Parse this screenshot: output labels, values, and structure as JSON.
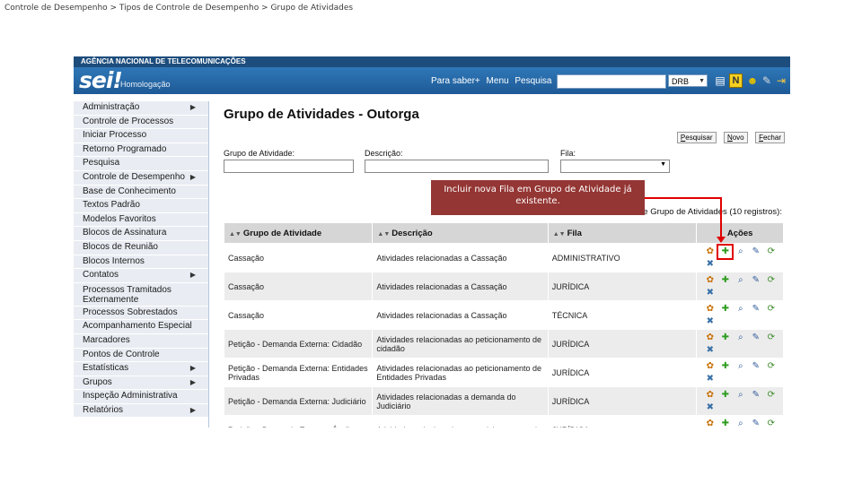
{
  "breadcrumb": "Controle de Desempenho > Tipos de Controle de Desempenho > Grupo de Atividades",
  "header": {
    "org": "AGÊNCIA NACIONAL DE TELECOMUNICAÇÕES",
    "logo": "sei!",
    "env": "Homologação",
    "links": [
      "Para saber+",
      "Menu",
      "Pesquisa"
    ],
    "unit": "DRB",
    "n_badge": "N"
  },
  "sidebar": {
    "items": [
      {
        "label": "Administração",
        "arrow": true
      },
      {
        "label": "Controle de Processos",
        "arrow": false
      },
      {
        "label": "Iniciar Processo",
        "arrow": false
      },
      {
        "label": "Retorno Programado",
        "arrow": false
      },
      {
        "label": "Pesquisa",
        "arrow": false
      },
      {
        "label": "Controle de Desempenho",
        "arrow": true
      },
      {
        "label": "Base de Conhecimento",
        "arrow": false
      },
      {
        "label": "Textos Padrão",
        "arrow": false
      },
      {
        "label": "Modelos Favoritos",
        "arrow": false
      },
      {
        "label": "Blocos de Assinatura",
        "arrow": false
      },
      {
        "label": "Blocos de Reunião",
        "arrow": false
      },
      {
        "label": "Blocos Internos",
        "arrow": false
      },
      {
        "label": "Contatos",
        "arrow": true
      },
      {
        "label": "Processos Tramitados Externamente",
        "arrow": false
      },
      {
        "label": "Processos Sobrestados",
        "arrow": false
      },
      {
        "label": "Acompanhamento Especial",
        "arrow": false
      },
      {
        "label": "Marcadores",
        "arrow": false
      },
      {
        "label": "Pontos de Controle",
        "arrow": false
      },
      {
        "label": "Estatísticas",
        "arrow": true
      },
      {
        "label": "Grupos",
        "arrow": true
      },
      {
        "label": "Inspeção Administrativa",
        "arrow": false
      },
      {
        "label": "Relatórios",
        "arrow": true
      }
    ]
  },
  "main": {
    "title": "Grupo de Atividades - Outorga",
    "buttons": {
      "search_key": "P",
      "search_rest": "esquisar",
      "new_key": "N",
      "new_rest": "ovo",
      "close_key": "F",
      "close_rest": "echar"
    },
    "filters": {
      "group_label": "Grupo de Atividade:",
      "desc_label": "Descrição:",
      "queue_label": "Fila:"
    },
    "caption": "de Grupo de Atividades (10 registros):",
    "columns": {
      "group": "Grupo de Atividade",
      "desc": "Descrição",
      "queue": "Fila",
      "actions": "Ações"
    },
    "rows": [
      {
        "group": "Cassação",
        "desc": "Atividades relacionadas a Cassação",
        "queue": "ADMINISTRATIVO"
      },
      {
        "group": "Cassação",
        "desc": "Atividades relacionadas a Cassação",
        "queue": "JURÍDICA"
      },
      {
        "group": "Cassação",
        "desc": "Atividades relacionadas a Cassação",
        "queue": "TÉCNICA"
      },
      {
        "group": "Petição - Demanda Externa: Cidadão",
        "desc": "Atividades relacionadas ao peticionamento de cidadão",
        "queue": "JURÍDICA"
      },
      {
        "group": "Petição - Demanda Externa: Entidades Privadas",
        "desc": "Atividades relacionadas ao peticionamento de Entidades Privadas",
        "queue": "JURÍDICA"
      },
      {
        "group": "Petição - Demanda Externa: Judiciário",
        "desc": "Atividades relacionadas a demanda do Judiciário",
        "queue": "JURÍDICA"
      },
      {
        "group": "Petição - Demanda Externa: Órgãos",
        "desc": "Atividades relacionadas ao peticionamento de",
        "queue": "JURÍDICA"
      }
    ]
  },
  "callout": "Incluir nova Fila em Grupo de Atividade já existente."
}
